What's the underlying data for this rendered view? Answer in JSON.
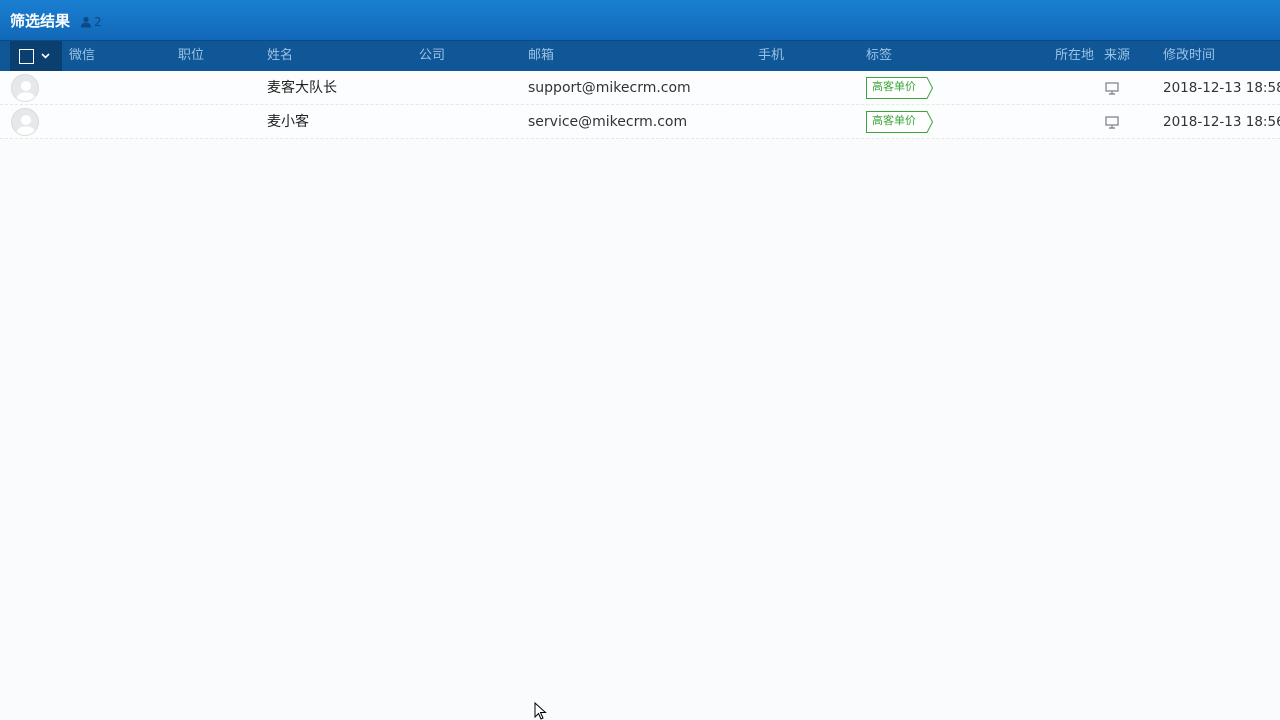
{
  "title": "筛选结果",
  "result_count": "2",
  "header": {
    "wechat": "微信",
    "position": "职位",
    "name": "姓名",
    "company": "公司",
    "email": "邮箱",
    "phone": "手机",
    "tags": "标签",
    "location": "所在地",
    "source": "来源",
    "modified_time": "修改时间"
  },
  "rows": [
    {
      "name": "麦客大队长",
      "email": "support@mikecrm.com",
      "tag": "高客单价",
      "source_icon": "desktop-icon",
      "modified_time": "2018-12-13 18:58"
    },
    {
      "name": "麦小客",
      "email": "service@mikecrm.com",
      "tag": "高客单价",
      "source_icon": "desktop-icon",
      "modified_time": "2018-12-13 18:56"
    }
  ],
  "colors": {
    "titlebar": "#1a7fd1",
    "header": "#0f5797",
    "header_text": "#9cc2e4",
    "tag_green": "#3aa53a"
  }
}
